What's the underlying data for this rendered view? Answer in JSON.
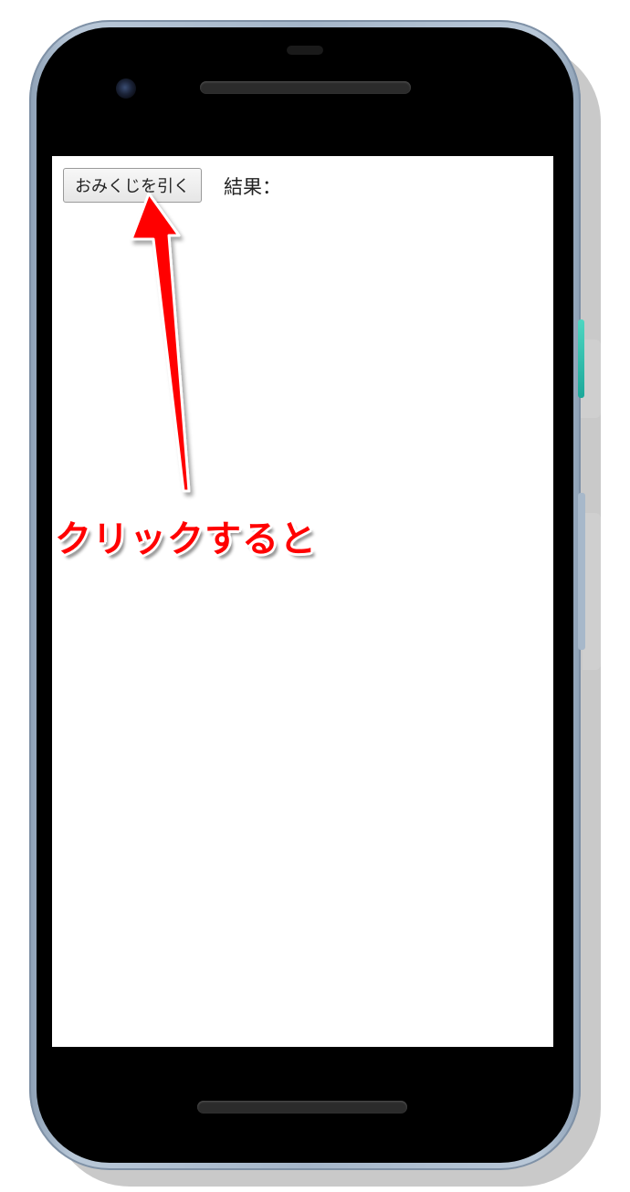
{
  "app": {
    "draw_button_label": "おみくじを引く",
    "result_label": "結果："
  },
  "annotation": {
    "text": "クリックすると",
    "color": "#ff0000"
  },
  "device": {
    "frame_color": "#a5b6c9",
    "accent_button_color": "#2ec4b0"
  }
}
